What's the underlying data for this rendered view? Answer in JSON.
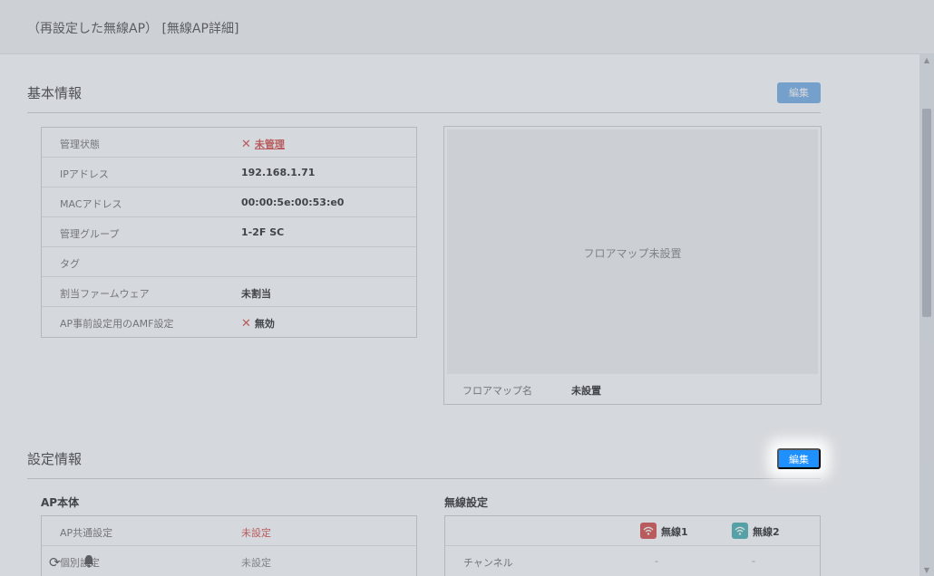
{
  "header": {
    "title": "（再設定した無線AP） [無線AP詳細]"
  },
  "basic": {
    "title": "基本情報",
    "edit_label": "編集",
    "rows": [
      {
        "key": "管理状態",
        "value": "未管理"
      },
      {
        "key": "IPアドレス",
        "value": "192.168.1.71"
      },
      {
        "key": "MACアドレス",
        "value": "00:00:5e:00:53:e0"
      },
      {
        "key": "管理グループ",
        "value": "1-2F SC"
      },
      {
        "key": "タグ",
        "value": ""
      },
      {
        "key": "割当ファームウェア",
        "value": "未割当"
      },
      {
        "key": "AP事前設定用のAMF設定",
        "value": "無効"
      }
    ],
    "floormap": {
      "empty_text": "フロアマップ未設置",
      "name_label": "フロアマップ名",
      "name_value": "未設置"
    }
  },
  "settings": {
    "title": "設定情報",
    "edit_label": "編集",
    "ap_body": {
      "title": "AP本体",
      "rows": [
        {
          "key": "AP共通設定",
          "value": "未設定"
        },
        {
          "key": "個別設定",
          "value": "未設定"
        }
      ]
    },
    "wireless": {
      "title": "無線設定",
      "radio1": "無線1",
      "radio2": "無線2",
      "rows": [
        {
          "key": "チャンネル",
          "radio1": "-",
          "radio2": "-"
        }
      ]
    }
  },
  "icons": {
    "close": "x-mark-icon",
    "wifi": "wifi-icon",
    "refresh": "refresh-icon",
    "bell": "bell-icon"
  },
  "colors": {
    "accent": "#1e90ff",
    "danger": "#d9534f",
    "radio1": "#d9534f",
    "radio2": "#4fb3b3"
  }
}
